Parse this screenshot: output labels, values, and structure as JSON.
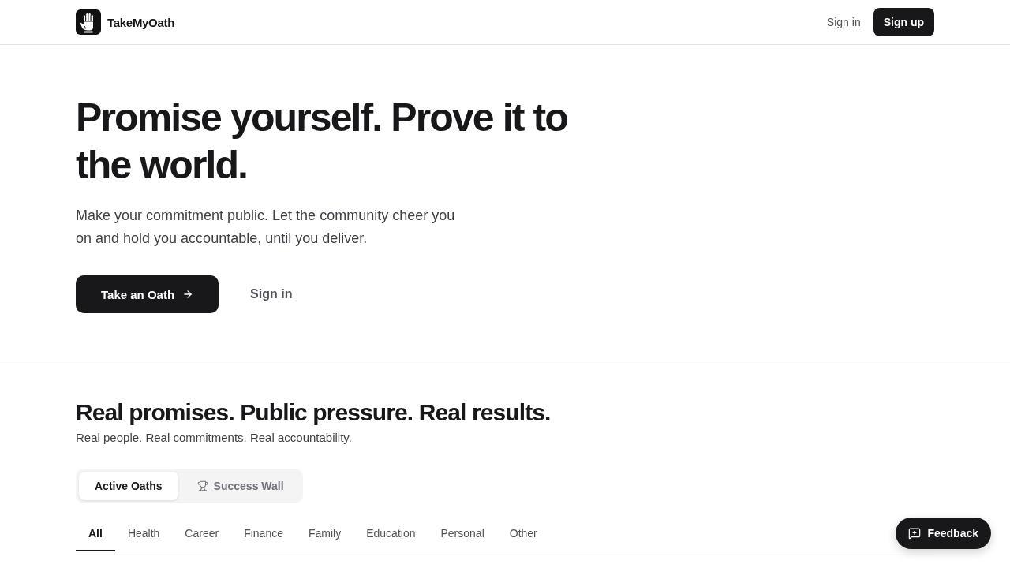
{
  "header": {
    "brand": "TakeMyOath",
    "sign_in": "Sign in",
    "sign_up": "Sign up"
  },
  "hero": {
    "title": "Promise yourself. Prove it to the world.",
    "subtitle": "Make your commitment public. Let the community cheer you on and hold you accountable, until you deliver.",
    "primary_button": "Take an Oath",
    "secondary_button": "Sign in"
  },
  "section": {
    "title": "Real promises. Public pressure. Real results.",
    "subtitle": "Real people. Real commitments. Real accountability.",
    "view_tabs": [
      {
        "label": "Active Oaths",
        "selected": true
      },
      {
        "label": "Success Wall",
        "selected": false
      }
    ],
    "categories": [
      {
        "label": "All",
        "selected": true
      },
      {
        "label": "Health",
        "selected": false
      },
      {
        "label": "Career",
        "selected": false
      },
      {
        "label": "Finance",
        "selected": false
      },
      {
        "label": "Family",
        "selected": false
      },
      {
        "label": "Education",
        "selected": false
      },
      {
        "label": "Personal",
        "selected": false
      },
      {
        "label": "Other",
        "selected": false
      }
    ]
  },
  "feedback_button": "Feedback"
}
